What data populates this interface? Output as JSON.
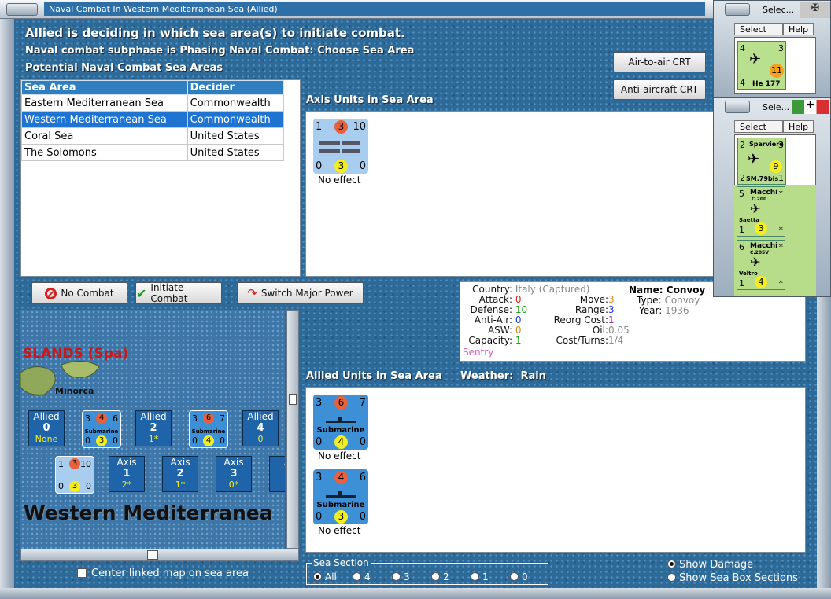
{
  "window": {
    "title": "Naval Combat In Western Mediterranean Sea (Allied)"
  },
  "messages": {
    "line1": "Allied is deciding in which sea area(s) to initiate combat.",
    "line2": "Naval combat subphase is Phasing Naval Combat: Choose Sea Area",
    "line3": "Potential Naval Combat Sea Areas"
  },
  "sea_table": {
    "headers": [
      "Sea Area",
      "Decider"
    ],
    "rows": [
      [
        "Eastern Mediterranean Sea",
        "Commonwealth"
      ],
      [
        "Western Mediterranean Sea",
        "Commonwealth"
      ],
      [
        "Coral Sea",
        "United States"
      ],
      [
        "The Solomons",
        "United States"
      ]
    ],
    "selected_row": 1
  },
  "crt_buttons": {
    "air": "Air-to-air CRT",
    "aa": "Anti-aircraft CRT"
  },
  "axis_panel": {
    "label": "Axis Units in Sea Area",
    "unit": {
      "tl": "1",
      "red": "3",
      "tr": "10",
      "bl": "0",
      "yel": "3",
      "br": "0",
      "status": "No effect"
    }
  },
  "actions": {
    "no_combat": "No Combat",
    "initiate": "Initiate Combat",
    "switch": "Switch Major Power"
  },
  "info": {
    "country_k": "Country:",
    "country_v": "Italy (Captured)",
    "attack_k": "Attack:",
    "attack_v": "0",
    "defense_k": "Defense:",
    "defense_v": "10",
    "aa_k": "Anti-Air:",
    "aa_v": "0",
    "asw_k": "ASW:",
    "asw_v": "0",
    "cap_k": "Capacity:",
    "cap_v": "1",
    "sentry": "Sentry",
    "move_k": "Move:",
    "move_v": "3",
    "range_k": "Range:",
    "range_v": "3",
    "reorg_k": "Reorg Cost:",
    "reorg_v": "1",
    "oil_k": "Oil:",
    "oil_v": "0.05",
    "cost_k": "Cost/Turns:",
    "cost_v": "1/4",
    "name_k": "Name:",
    "name_v": "Convoy",
    "type_k": "Type:",
    "type_v": "Convoy",
    "year_k": "Year:",
    "year_v": "1936"
  },
  "allied_panel": {
    "label": "Allied Units in Sea Area",
    "weather_k": "Weather:",
    "weather_v": "Rain",
    "units": [
      {
        "tl": "3",
        "red": "6",
        "tr": "7",
        "name": "Submarine",
        "bl": "0",
        "yel": "4",
        "br": "0",
        "status": "No effect"
      },
      {
        "tl": "3",
        "red": "4",
        "tr": "6",
        "name": "Submarine",
        "bl": "0",
        "yel": "3",
        "br": "0",
        "status": "No effect"
      }
    ]
  },
  "map": {
    "islands_label": "SLANDS (Spa)",
    "minorca": "Minorca",
    "sea_name": "Western Mediterranea",
    "allied_boxes": [
      {
        "side": "Allied",
        "num": "0",
        "sub": "None"
      },
      {
        "side": "Allied",
        "num": "2",
        "sub": "1*"
      },
      {
        "side": "Allied",
        "num": "4",
        "sub": "0"
      }
    ],
    "axis_boxes": [
      {
        "side": "Axis",
        "num": "1",
        "sub": "2*"
      },
      {
        "side": "Axis",
        "num": "2",
        "sub": "1*"
      },
      {
        "side": "Axis",
        "num": "3",
        "sub": "0*"
      },
      {
        "side": "A",
        "num": "",
        "sub": ""
      }
    ],
    "map_counters": [
      {
        "tl": "3",
        "red": "4",
        "tr": "6",
        "name": "Submarine",
        "bl": "0",
        "yel": "3",
        "br": "0"
      },
      {
        "tl": "3",
        "red": "6",
        "tr": "7",
        "name": "Submarine",
        "bl": "0",
        "yel": "4",
        "br": "0"
      },
      {
        "tl": "1",
        "red": "3",
        "tr": "10",
        "bl": "0",
        "yel": "3",
        "br": "0"
      }
    ]
  },
  "center_linked": "Center linked map on sea area",
  "sea_section": {
    "legend": "Sea Section",
    "options": [
      "All",
      "4",
      "3",
      "2",
      "1",
      "0"
    ],
    "selected": 0
  },
  "display_options": {
    "damage": "Show Damage",
    "sections": "Show Sea Box Sections"
  },
  "popup1": {
    "title": "Selec...",
    "select": "Select",
    "help": "Help",
    "unit": {
      "tl": "4",
      "tr": "3",
      "num": "11",
      "bl": "4",
      "name": "He 177"
    }
  },
  "popup2": {
    "title": "Sele...",
    "select": "Select",
    "help": "Help",
    "units": [
      {
        "tl": "2",
        "title": "Sparviero",
        "tr": "3",
        "num": "9",
        "bl": "2",
        "name": "SM.79bis",
        "br": "1"
      },
      {
        "tl": "5",
        "title": "Macchi",
        "sub": "C.200",
        "tr": "*",
        "label": "Saetta",
        "bl": "1",
        "num": "3",
        "br": "*"
      },
      {
        "tl": "6",
        "title": "Macchi",
        "sub": "C.205V",
        "tr": "*",
        "label": "Veltro",
        "bl": "1",
        "num": "4",
        "br": "*"
      }
    ]
  },
  "colors": {
    "accent": "#2f7fc0",
    "selected_row": "#1e74d0",
    "sea": "#2e6a98",
    "counter_blue": "#3d8fd6"
  }
}
